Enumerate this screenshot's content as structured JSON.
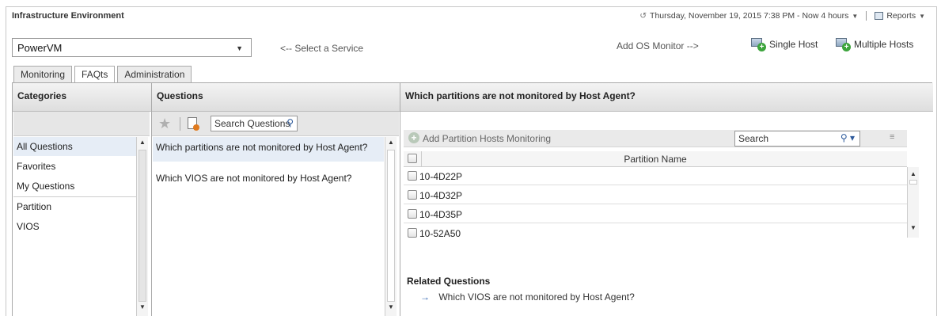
{
  "header": {
    "title": "Infrastructure Environment",
    "datetime": "Thursday, November 19, 2015 7:38 PM - Now 4 hours",
    "reports_label": "Reports"
  },
  "service": {
    "selected": "PowerVM",
    "hint": "<-- Select a Service"
  },
  "monitor": {
    "add_os_label": "Add OS Monitor -->",
    "single_host_label": "Single Host",
    "multiple_hosts_label": "Multiple Hosts"
  },
  "tabs": [
    {
      "label": "Monitoring"
    },
    {
      "label": "FAQts"
    },
    {
      "label": "Administration"
    }
  ],
  "categories": {
    "header": "Categories",
    "items": [
      {
        "label": "All Questions"
      },
      {
        "label": "Favorites"
      },
      {
        "label": "My Questions"
      },
      {
        "label": "Partition"
      },
      {
        "label": "VIOS"
      }
    ]
  },
  "questions": {
    "header": "Questions",
    "search_placeholder": "Search Questions",
    "items": [
      {
        "label": "Which partitions are not monitored by Host Agent?"
      },
      {
        "label": "Which VIOS are not monitored by Host Agent?"
      }
    ]
  },
  "detail": {
    "title": "Which partitions are not monitored by Host Agent?",
    "add_button": "Add Partition Hosts Monitoring",
    "search_placeholder": "Search",
    "column_header": "Partition Name",
    "rows": [
      {
        "name": "10-4D22P"
      },
      {
        "name": "10-4D32P"
      },
      {
        "name": "10-4D35P"
      },
      {
        "name": "10-52A50"
      }
    ],
    "related_title": "Related Questions",
    "related_items": [
      {
        "label": "Which VIOS are not monitored by Host Agent?"
      }
    ]
  }
}
